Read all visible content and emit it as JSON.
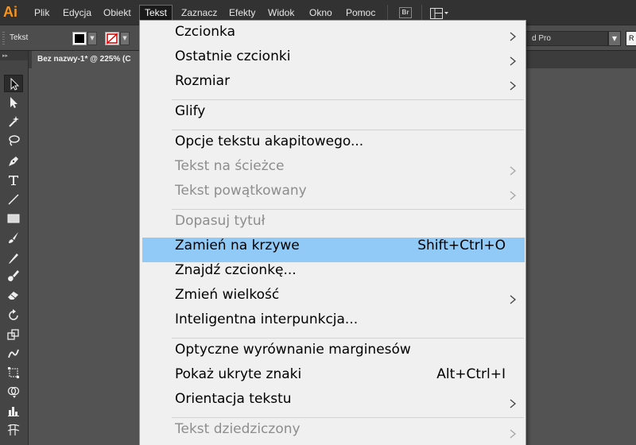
{
  "app": {
    "logo": "Ai",
    "accent_color": "#f7941e"
  },
  "menubar": {
    "items": [
      {
        "label": "Plik"
      },
      {
        "label": "Edycja"
      },
      {
        "label": "Obiekt"
      },
      {
        "label": "Tekst",
        "active": true
      },
      {
        "label": "Zaznacz"
      },
      {
        "label": "Efekty"
      },
      {
        "label": "Widok"
      },
      {
        "label": "Okno"
      },
      {
        "label": "Pomoc"
      }
    ],
    "bridge_label": "Br",
    "workspace_icon": "workspace-layout-icon"
  },
  "controlbar": {
    "label": "Tekst",
    "fill_color": "#000000",
    "stroke": "none",
    "font_family_visible": "d Pro",
    "font_size_visible": "R"
  },
  "document_tab": {
    "title": "Bez nazwy-1* @ 225% (C"
  },
  "tools": [
    {
      "name": "selection-tool-icon",
      "selected": true
    },
    {
      "name": "direct-selection-tool-icon"
    },
    {
      "name": "magic-wand-tool-icon"
    },
    {
      "name": "lasso-tool-icon"
    },
    {
      "name": "pen-tool-icon"
    },
    {
      "name": "type-tool-icon"
    },
    {
      "name": "line-segment-tool-icon"
    },
    {
      "name": "rectangle-tool-icon"
    },
    {
      "name": "paintbrush-tool-icon"
    },
    {
      "name": "pencil-tool-icon"
    },
    {
      "name": "blob-brush-tool-icon"
    },
    {
      "name": "eraser-tool-icon"
    },
    {
      "name": "rotate-tool-icon"
    },
    {
      "name": "scale-tool-icon"
    },
    {
      "name": "warp-tool-icon"
    },
    {
      "name": "free-transform-tool-icon"
    },
    {
      "name": "shape-builder-tool-icon"
    },
    {
      "name": "graph-tool-icon"
    },
    {
      "name": "mesh-tool-icon"
    }
  ],
  "menu": {
    "highlight_color": "#91c9f7",
    "items": [
      {
        "label": "Czcionka",
        "submenu": true
      },
      {
        "label": "Ostatnie czcionki",
        "submenu": true
      },
      {
        "label": "Rozmiar",
        "submenu": true
      },
      {
        "separator": true
      },
      {
        "label": "Glify"
      },
      {
        "separator": true
      },
      {
        "label": "Opcje tekstu akapitowego..."
      },
      {
        "label": "Tekst na ścieżce",
        "submenu": true,
        "disabled": true
      },
      {
        "label": "Tekst powątkowany",
        "submenu": true,
        "disabled": true
      },
      {
        "separator": true
      },
      {
        "label": "Dopasuj tytuł",
        "disabled": true
      },
      {
        "label": "Zamień na krzywe",
        "shortcut": "Shift+Ctrl+O",
        "highlighted": true
      },
      {
        "label": "Znajdź czcionkę..."
      },
      {
        "label": "Zmień wielkość",
        "submenu": true
      },
      {
        "label": "Inteligentna interpunkcja..."
      },
      {
        "separator": true
      },
      {
        "label": "Optyczne wyrównanie marginesów"
      },
      {
        "label": "Pokaż ukryte znaki",
        "shortcut": "Alt+Ctrl+I"
      },
      {
        "label": "Orientacja tekstu",
        "submenu": true
      },
      {
        "separator": true
      },
      {
        "label": "Tekst dziedziczony",
        "submenu": true,
        "disabled": true
      }
    ]
  }
}
